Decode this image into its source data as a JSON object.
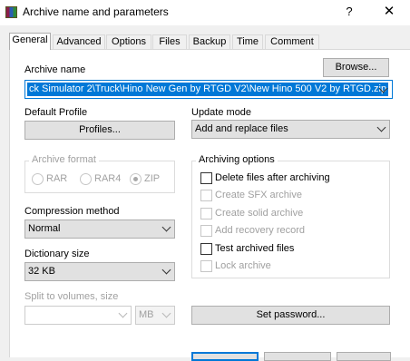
{
  "window": {
    "title": "Archive name and parameters",
    "help": "?",
    "close": "✕"
  },
  "tabs": [
    "General",
    "Advanced",
    "Options",
    "Files",
    "Backup",
    "Time",
    "Comment"
  ],
  "archive_name": {
    "label": "Archive name",
    "browse_button": "Browse...",
    "value": "ck Simulator 2\\Truck\\Hino New Gen by RTGD V2\\New Hino 500 V2 by RTGD.zip"
  },
  "default_profile": {
    "label": "Default Profile",
    "profiles_button": "Profiles..."
  },
  "update_mode": {
    "label": "Update mode",
    "value": "Add and replace files"
  },
  "archive_format": {
    "label": "Archive format",
    "options": [
      "RAR",
      "RAR4",
      "ZIP"
    ],
    "selected": "ZIP"
  },
  "archiving_options": {
    "label": "Archiving options",
    "items": [
      {
        "label": "Delete files after archiving",
        "enabled": true,
        "checked": false
      },
      {
        "label": "Create SFX archive",
        "enabled": false,
        "checked": false
      },
      {
        "label": "Create solid archive",
        "enabled": false,
        "checked": false
      },
      {
        "label": "Add recovery record",
        "enabled": false,
        "checked": false
      },
      {
        "label": "Test archived files",
        "enabled": true,
        "checked": false
      },
      {
        "label": "Lock archive",
        "enabled": false,
        "checked": false
      }
    ]
  },
  "compression_method": {
    "label": "Compression method",
    "value": "Normal"
  },
  "dictionary_size": {
    "label": "Dictionary size",
    "value": "32 KB"
  },
  "split_volumes": {
    "label": "Split to volumes, size",
    "value": "",
    "unit": "MB"
  },
  "set_password_button": "Set password...",
  "colors": {
    "accent": "#0078d7",
    "button_bg": "#e1e1e1",
    "disabled_text": "#a0a0a0"
  }
}
